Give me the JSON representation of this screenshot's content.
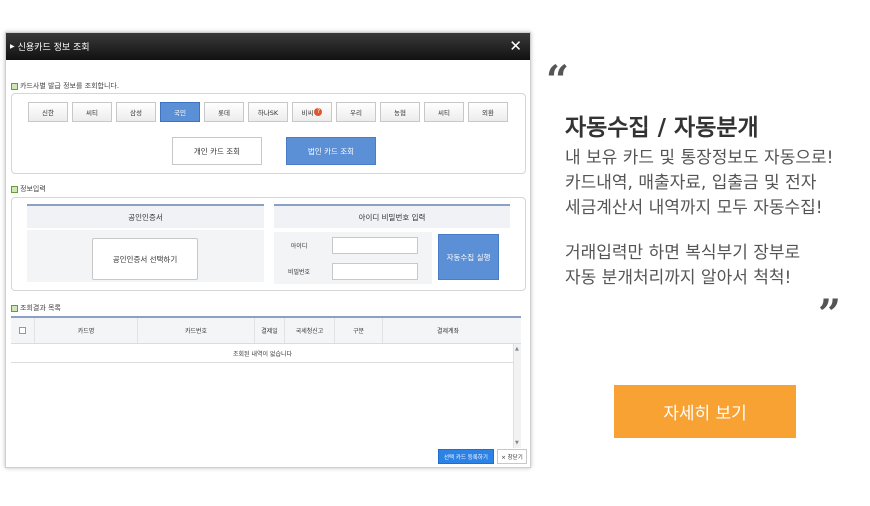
{
  "dialog": {
    "title": "신용카드 정보 조회",
    "close_glyph": "✕",
    "section_bank": "카드사별 발급 정보를 조회합니다.",
    "banks": [
      "신한",
      "씨티",
      "삼성",
      "국민",
      "롯데",
      "하나SK",
      "비씨",
      "우리",
      "농협",
      "씨티",
      "외환"
    ],
    "bank_active_index": 3,
    "bank_help_index": 6,
    "bank_help_glyph": "?",
    "personal_card_btn": "개인 카드 조회",
    "corporate_card_btn": "법인 카드 조회",
    "section_info": "정보입력",
    "cert_header": "공인인증서",
    "cert_select_btn": "공인인증서 선택하기",
    "idpw_header": "아이디 비밀번호 입력",
    "id_label": "아이디",
    "pw_label": "비밀번호",
    "id_value": "",
    "pw_value": "",
    "run_btn": "자동수집 실행",
    "section_results": "조회결과 목록",
    "columns": [
      "",
      "카드명",
      "카드번호",
      "결제일",
      "국세청신고",
      "구분",
      "결제계좌"
    ],
    "empty_message": "조회된 내역이 없습니다",
    "register_btn": "선택 카드 등록하기",
    "close_btn": "× 창닫기"
  },
  "promo": {
    "quote_open": "“",
    "quote_close": "”",
    "headline": "자동수집 / 자동분개",
    "lines_1": [
      "내 보유 카드 및 통장정보도 자동으로!",
      "카드내역, 매출자료, 입출금 및 전자",
      "세금계산서 내역까지 모두 자동수집!"
    ],
    "lines_2": [
      "거래입력만 하면 복식부기 장부로",
      "자동 분개처리까지 알아서 척척!"
    ],
    "cta": "자세히 보기",
    "cta_color": "#f7a233"
  }
}
